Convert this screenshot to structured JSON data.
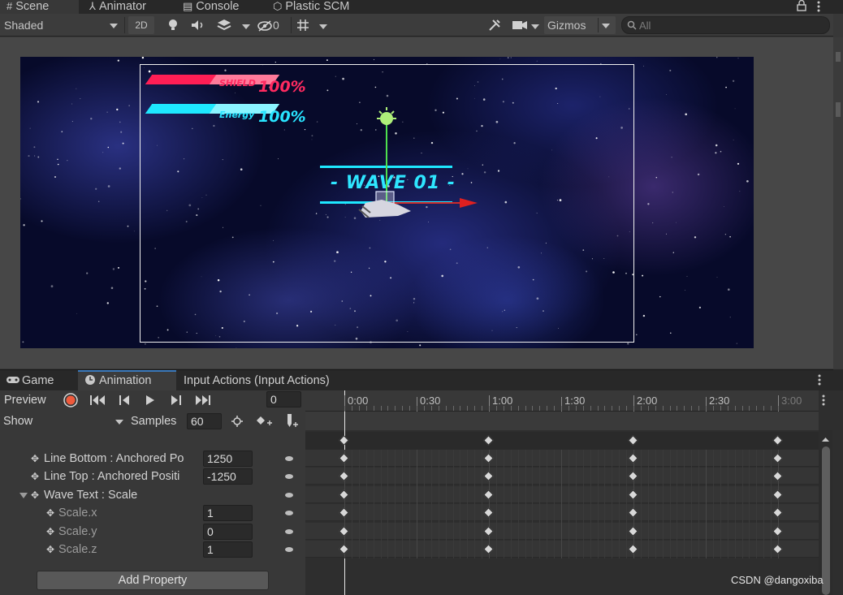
{
  "top_tabs": [
    {
      "icon": "#",
      "label": "Scene"
    },
    {
      "icon": "⅄",
      "label": "Animator"
    },
    {
      "icon": "▤",
      "label": "Console"
    },
    {
      "icon": "⬡",
      "label": "Plastic SCM"
    }
  ],
  "scene_toolbar": {
    "draw_mode": "Shaded",
    "mode_2d": "2D",
    "hidden_count": "0",
    "gizmos": "Gizmos",
    "search_placeholder": "All"
  },
  "hud": {
    "shield_label": "SHIELD",
    "shield_value": "100%",
    "energy_label": "Energy",
    "energy_value": "100%",
    "wave_text": "- WAVE 01 -"
  },
  "bottom_tabs": [
    {
      "icon": "🎮",
      "label": "Game"
    },
    {
      "icon": "◷",
      "label": "Animation"
    },
    {
      "icon": "",
      "label": "Input Actions (Input Actions)"
    }
  ],
  "animation": {
    "preview_label": "Preview",
    "frame": "0",
    "show_label": "Show",
    "samples_label": "Samples",
    "samples_value": "60",
    "ruler_labels": [
      "0:00",
      "0:30",
      "1:00",
      "1:30",
      "2:00",
      "2:30",
      "3:00"
    ],
    "properties": [
      {
        "label": "Line Bottom : Anchored Po",
        "value": "1250"
      },
      {
        "label": "Line Top : Anchored Positi",
        "value": "-1250"
      },
      {
        "label": "Wave Text : Scale",
        "value": ""
      },
      {
        "label": "Scale.x",
        "value": "1"
      },
      {
        "label": "Scale.y",
        "value": "0"
      },
      {
        "label": "Scale.z",
        "value": "1"
      }
    ],
    "keyframe_times": [
      "0:00",
      "1:00",
      "2:00",
      "3:00"
    ],
    "add_property": "Add Property"
  },
  "watermark": "CSDN @dangoxiba",
  "colors": {
    "shield_bar": "#ff1e55",
    "energy_bar": "#1ee8ff",
    "wave_text": "#2ee6ff",
    "accent": "#3a79bb"
  }
}
